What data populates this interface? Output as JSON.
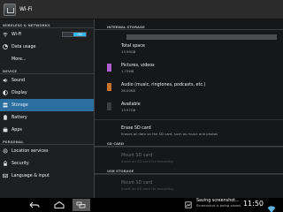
{
  "window": {
    "title": "Wi-Fi"
  },
  "sidebar": {
    "sections": [
      {
        "header": "WIRELESS & NETWORKS",
        "items": [
          {
            "label": "Wi-Fi",
            "icon": "wifi-icon",
            "toggle": "ON"
          },
          {
            "label": "Data usage",
            "icon": "data-usage-icon"
          },
          {
            "label": "More...",
            "icon": ""
          }
        ]
      },
      {
        "header": "DEVICE",
        "items": [
          {
            "label": "Sound",
            "icon": "speaker-icon"
          },
          {
            "label": "Display",
            "icon": "display-icon"
          },
          {
            "label": "Storage",
            "icon": "storage-icon",
            "selected": true
          },
          {
            "label": "Battery",
            "icon": "battery-icon"
          },
          {
            "label": "Apps",
            "icon": "apps-icon"
          }
        ]
      },
      {
        "header": "PERSONAL",
        "items": [
          {
            "label": "Location services",
            "icon": "location-icon"
          },
          {
            "label": "Security",
            "icon": "lock-icon"
          },
          {
            "label": "Language & input",
            "icon": "keyboard-icon"
          }
        ]
      }
    ]
  },
  "storage": {
    "internal_header": "INTERNAL STORAGE",
    "total": {
      "title": "Total space",
      "value": "13.99GB"
    },
    "entries": [
      {
        "title": "Pictures, videos",
        "value": "1.73MB",
        "color": "#b05fd0"
      },
      {
        "title": "Audio (music, ringtones, podcasts, etc.)",
        "value": "28.00KB",
        "color": "#c8742d"
      },
      {
        "title": "Available",
        "value": "13.97GB",
        "color": "#3a3d40"
      }
    ],
    "erase": {
      "title": "Erase SD card",
      "desc": "Erases all data on the SD card, such as music and photos"
    },
    "sd_header": "SD CARD",
    "sd_mount": {
      "title": "Mount SD card",
      "desc": "Insert an SD card for mounting"
    },
    "usb_header": "USB STORAGE",
    "usb_mount": {
      "title": "Mount SD card",
      "desc": "Insert an SD card for mounting"
    }
  },
  "navbar": {
    "toast_title": "Saving screenshot...",
    "toast_sub": "Screenshot is being saved.",
    "clock": "11:50"
  }
}
